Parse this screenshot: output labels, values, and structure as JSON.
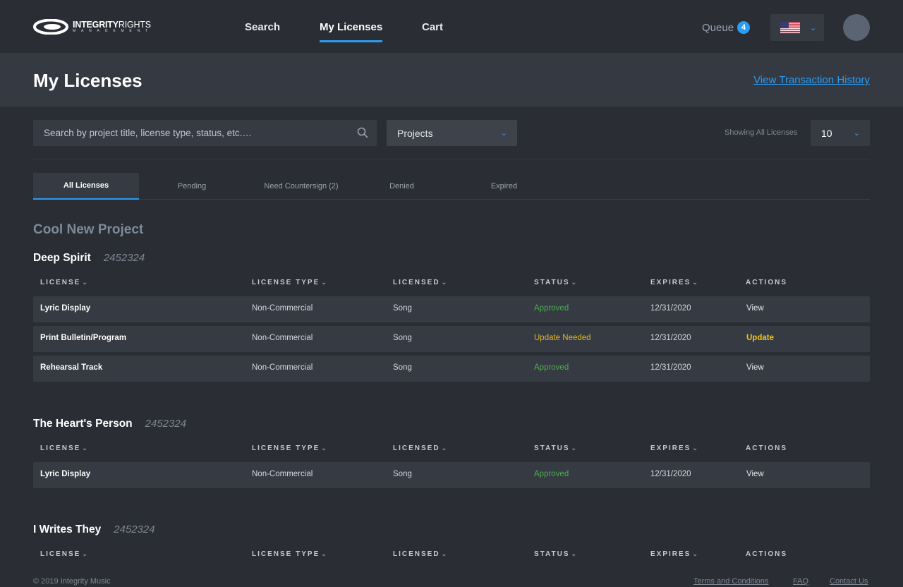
{
  "nav": {
    "logo_main": "INTEGRITY",
    "logo_main_light": "RIGHTS",
    "logo_sub": "MANAGEMENT",
    "links": [
      "Search",
      "My Licenses",
      "Cart"
    ],
    "queue_label": "Queue",
    "queue_count": "4",
    "locale_icon": "us-flag-icon",
    "accent_color": "#2a9df4"
  },
  "header": {
    "title": "My Licenses",
    "transaction_link": "View Transaction History"
  },
  "filters": {
    "search_placeholder": "Search by project title, license type, status, etc.…",
    "projects_selected": "Projects",
    "showing_label": "Showing All Licenses",
    "per_page": "10"
  },
  "tabs": [
    "All Licenses",
    "Pending",
    "Need Countersign (2)",
    "Denied",
    "Expired"
  ],
  "columns": [
    "LICENSE",
    "LICENSE TYPE",
    "LICENSED",
    "STATUS",
    "EXPIRES",
    "ACTIONS"
  ],
  "project": {
    "name": "Cool New Project",
    "songs": [
      {
        "title": "Deep Spirit",
        "id": "2452324",
        "rows": [
          {
            "license": "Lyric Display",
            "type": "Non-Commercial",
            "licensed": "Song",
            "status": "Approved",
            "expires": "12/31/2020",
            "action": "View"
          },
          {
            "license": "Print Bulletin/Program",
            "type": "Non-Commercial",
            "licensed": "Song",
            "status": "Update Needed",
            "expires": "12/31/2020",
            "action": "Update"
          },
          {
            "license": "Rehearsal Track",
            "type": "Non-Commercial",
            "licensed": "Song",
            "status": "Approved",
            "expires": "12/31/2020",
            "action": "View"
          }
        ]
      },
      {
        "title": "The Heart's Person",
        "id": "2452324",
        "rows": [
          {
            "license": "Lyric Display",
            "type": "Non-Commercial",
            "licensed": "Song",
            "status": "Approved",
            "expires": "12/31/2020",
            "action": "View"
          }
        ]
      },
      {
        "title": "I Writes They",
        "id": "2452324",
        "rows": []
      }
    ]
  },
  "status_colors": {
    "approved": "#4caf50",
    "update_needed": "#e6b422"
  },
  "footer": {
    "copyright": "© 2019 Integrity Music",
    "links": [
      "Terms and Conditions",
      "FAQ",
      "Contact Us"
    ]
  }
}
